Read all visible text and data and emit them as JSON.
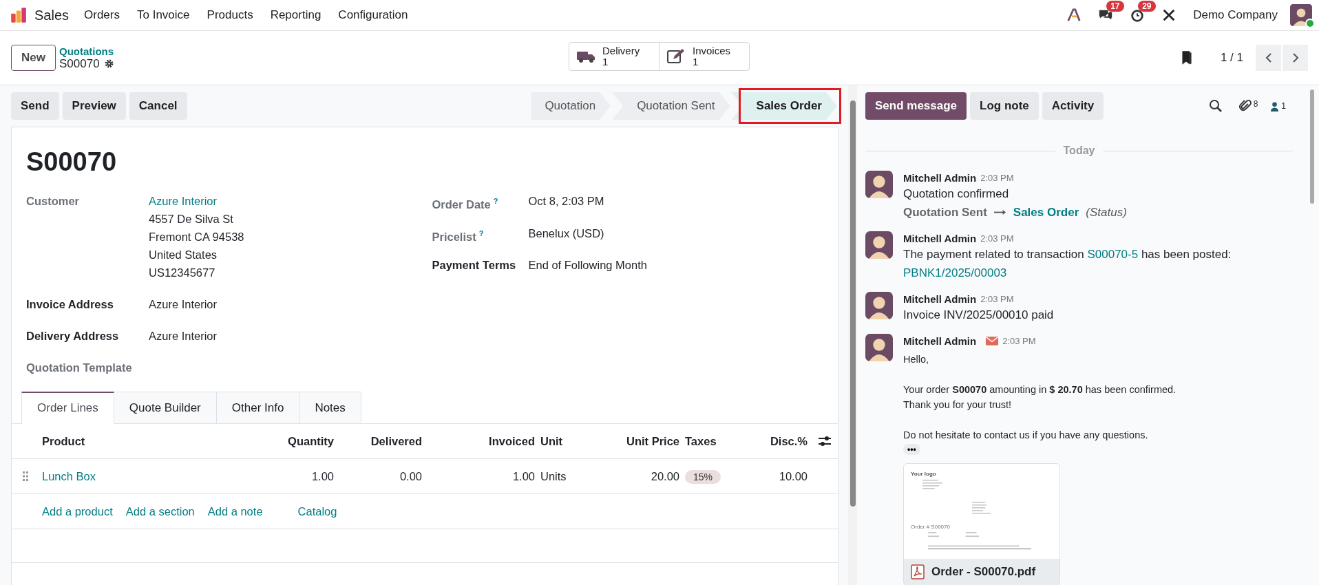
{
  "app": {
    "name": "Sales"
  },
  "menu": [
    {
      "label": "Orders"
    },
    {
      "label": "To Invoice"
    },
    {
      "label": "Products"
    },
    {
      "label": "Reporting"
    },
    {
      "label": "Configuration"
    }
  ],
  "systray": {
    "messages_badge": "17",
    "activities_badge": "29",
    "company": "Demo Company",
    "online": true
  },
  "control_panel": {
    "new_button": "New",
    "breadcrumb_parent": "Quotations",
    "breadcrumb_current": "S00070",
    "pager": "1 / 1"
  },
  "smart_buttons": [
    {
      "kind": "delivery",
      "label": "Delivery",
      "count": "1"
    },
    {
      "kind": "invoices",
      "label": "Invoices",
      "count": "1"
    }
  ],
  "actions": [
    "Send",
    "Preview",
    "Cancel"
  ],
  "stages": [
    {
      "label": "Quotation",
      "selected": false,
      "highlighted": false
    },
    {
      "label": "Quotation Sent",
      "selected": false,
      "highlighted": false
    },
    {
      "label": "Sales Order",
      "selected": true,
      "highlighted": true
    }
  ],
  "record": {
    "name": "S00070",
    "fields_left": [
      {
        "label": "Customer",
        "emphasis": false,
        "link": true,
        "value": "Azure Interior",
        "lines": [
          "4557 De Silva St",
          "Fremont CA 94538",
          "United States",
          "US12345677"
        ]
      },
      {
        "label": "Invoice Address",
        "emphasis": true,
        "link": false,
        "value": "Azure Interior"
      },
      {
        "label": "Delivery Address",
        "emphasis": true,
        "link": false,
        "value": "Azure Interior"
      },
      {
        "label": "Quotation Template",
        "emphasis": false
      }
    ],
    "fields_right": [
      {
        "label": "Order Date",
        "emphasis": false,
        "help": "?",
        "value": "Oct 8, 2:03 PM"
      },
      {
        "label": "Pricelist",
        "emphasis": false,
        "help": "?",
        "value": "Benelux (USD)"
      },
      {
        "label": "Payment Terms",
        "emphasis": true,
        "value": "End of Following Month"
      }
    ]
  },
  "tabs": [
    {
      "label": "Order Lines",
      "selected": true
    },
    {
      "label": "Quote Builder",
      "selected": false
    },
    {
      "label": "Other Info",
      "selected": false
    },
    {
      "label": "Notes",
      "selected": false
    }
  ],
  "table": {
    "columns": [
      {
        "label": "Product",
        "kind": "text"
      },
      {
        "label": "Quantity",
        "kind": "number"
      },
      {
        "label": "Delivered",
        "kind": "number"
      },
      {
        "label": "Invoiced",
        "kind": "number"
      },
      {
        "label": "Unit",
        "kind": "text"
      },
      {
        "label": "Unit Price",
        "kind": "number"
      },
      {
        "label": "Taxes",
        "kind": "tag"
      },
      {
        "label": "Disc.%",
        "kind": "number"
      }
    ],
    "rows": [
      {
        "cells": [
          "Lunch Box",
          "1.00",
          "0.00",
          "1.00",
          "Units",
          "20.00",
          "15%",
          "10.00"
        ]
      }
    ],
    "add_links": [
      "Add a product",
      "Add a section",
      "Add a note",
      "Catalog"
    ]
  },
  "chatter": {
    "buttons": [
      {
        "label": "Send message",
        "primary": true
      },
      {
        "label": "Log note",
        "primary": false
      },
      {
        "label": "Activity",
        "primary": false
      }
    ],
    "attachments_count": "8",
    "followers_count": "1",
    "divider": "Today",
    "messages": [
      {
        "kind": "tracking",
        "author": "Mitchell Admin",
        "time": "2:03 PM",
        "body": "Quotation confirmed",
        "old_value": "Quotation Sent",
        "new_value": "Sales Order",
        "field": "(Status)"
      },
      {
        "kind": "text",
        "author": "Mitchell Admin",
        "time": "2:03 PM",
        "parts": [
          {
            "text": "The payment related to transaction "
          },
          {
            "link": "S00070-5"
          },
          {
            "text": " has been posted: "
          },
          {
            "link": "PBNK1/2025/00003"
          }
        ]
      },
      {
        "kind": "text",
        "author": "Mitchell Admin",
        "time": "2:03 PM",
        "parts": [
          {
            "text": "Invoice INV/2025/00010 paid"
          }
        ]
      },
      {
        "kind": "email",
        "author": "Mitchell Admin",
        "time": "2:03 PM",
        "paragraphs": [
          [
            "Hello,"
          ],
          [
            "Your order **S00070** amounting in **$ 20.70** has been confirmed.",
            "Thank you for your trust!"
          ],
          [
            "Do not hesitate to contact us if you have any questions."
          ]
        ],
        "more": "•••",
        "attachment": {
          "name": "Order - S00070.pdf",
          "logo": "Your logo",
          "title": "Order # S00070"
        }
      }
    ]
  }
}
